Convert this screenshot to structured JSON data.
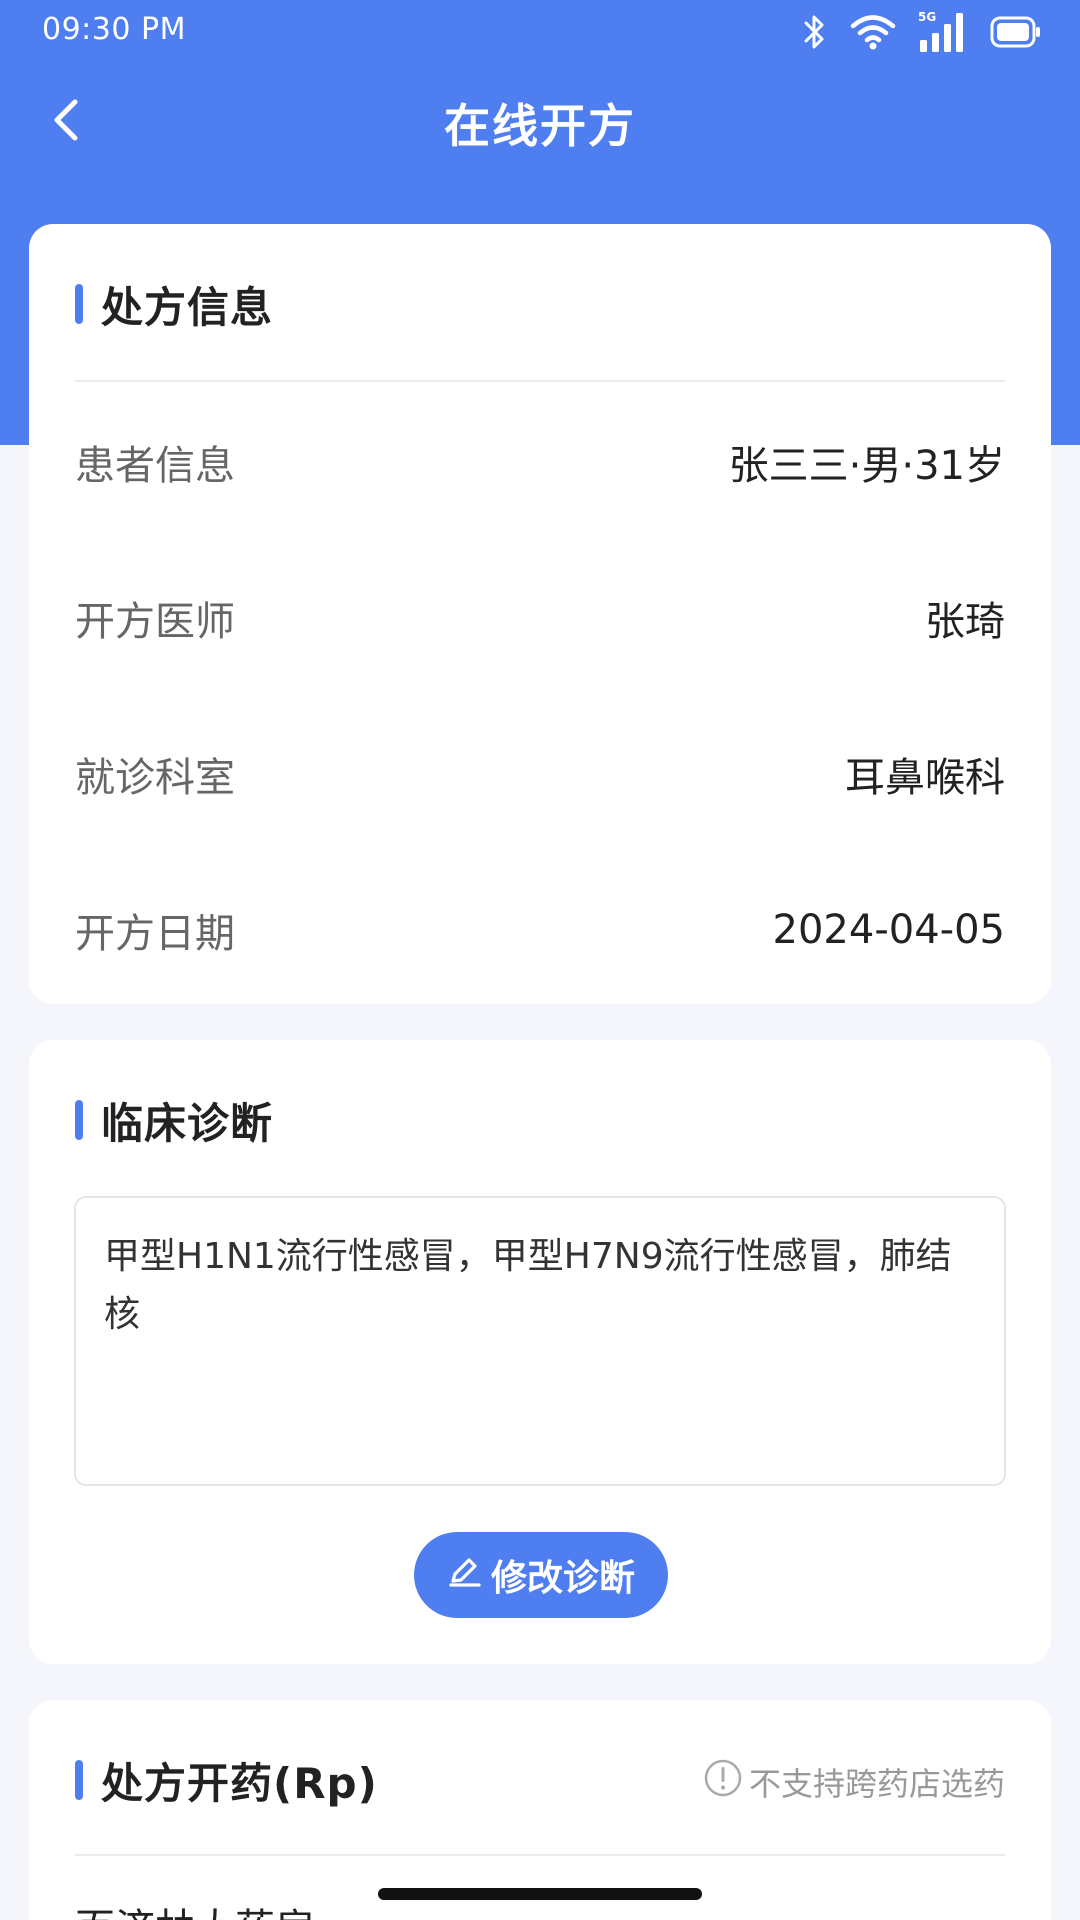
{
  "status_bar": {
    "time": "09:30 PM",
    "network": "5G",
    "icons": [
      "bluetooth-icon",
      "wifi-icon",
      "signal-icon",
      "battery-icon"
    ]
  },
  "header": {
    "title": "在线开方",
    "back_icon": "chevron-left-icon"
  },
  "prescription_info": {
    "title": "处方信息",
    "rows": [
      {
        "label": "患者信息",
        "value": "张三三·男·31岁"
      },
      {
        "label": "开方医师",
        "value": "张琦"
      },
      {
        "label": "就诊科室",
        "value": "耳鼻喉科"
      },
      {
        "label": "开方日期",
        "value": "2024-04-05"
      }
    ]
  },
  "diagnosis": {
    "title": "临床诊断",
    "text": "甲型H1N1流行性感冒，甲型H7N9流行性感冒，肺结核",
    "edit_button_label": "修改诊断"
  },
  "medication": {
    "title": "处方开药(Rp)",
    "notice": "不支持跨药店选药",
    "pharmacy": "百济林大药房"
  },
  "colors": {
    "accent": "#4e7ef0",
    "page_bg": "#f4f6fb",
    "card_bg": "#ffffff"
  }
}
